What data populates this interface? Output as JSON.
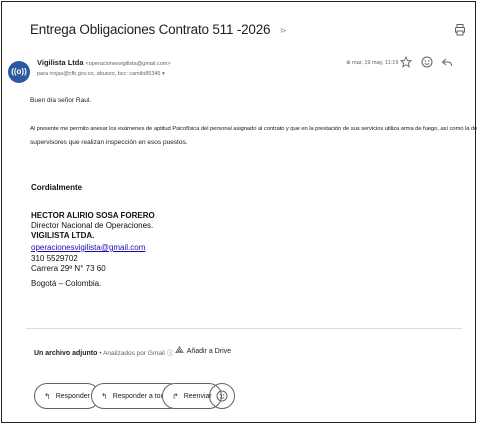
{
  "email": {
    "subject": "Entrega Obligaciones Contrato 511 -2026",
    "sender_name": "Vigilista Ltda",
    "sender_email": "<operacionesvigilista@gmail.com>",
    "recipients": "para rrojas@cfb.gov.co, abuezo, bcc: camilo85345",
    "date": "mar, 19 may, 11:19",
    "greeting": "Buen día señor Raul.",
    "body_line1": "Al presente me permito anexar los exámenes de aptitud Psicofísica del personal asignado al contrato y que en la prestación de sus servicios utiliza arma de fuego, así como la de los dos",
    "body_line2": "supervisores que realizan inspección en esos puestos.",
    "closing": "Cordialmente",
    "signature": {
      "name": "HECTOR ALIRIO SOSA FORERO",
      "role": "Director Nacional de Operaciones.",
      "company": "VIGILISTA LTDA.",
      "email": "operacionesvigilista@gmail.com",
      "phone": "310 5529702",
      "address": "Carrera 29ª N° 73 60",
      "city": "Bogotá – Colombia."
    },
    "avatar_text": "((o))"
  },
  "attachments": {
    "label": "Un archivo adjunto",
    "scanned": "• Analizados por Gmail",
    "drive": "Añadir a Drive"
  },
  "actions": {
    "reply": "Responder",
    "reply_all": "Responder a todos",
    "forward": "Reenviar"
  },
  "colors": {
    "link": "#1a0dab",
    "avatar": "#2c5aa0"
  },
  "icons": [
    "print-icon",
    "attachment-icon",
    "star-icon",
    "emoji-icon",
    "reply-icon",
    "drive-icon"
  ]
}
